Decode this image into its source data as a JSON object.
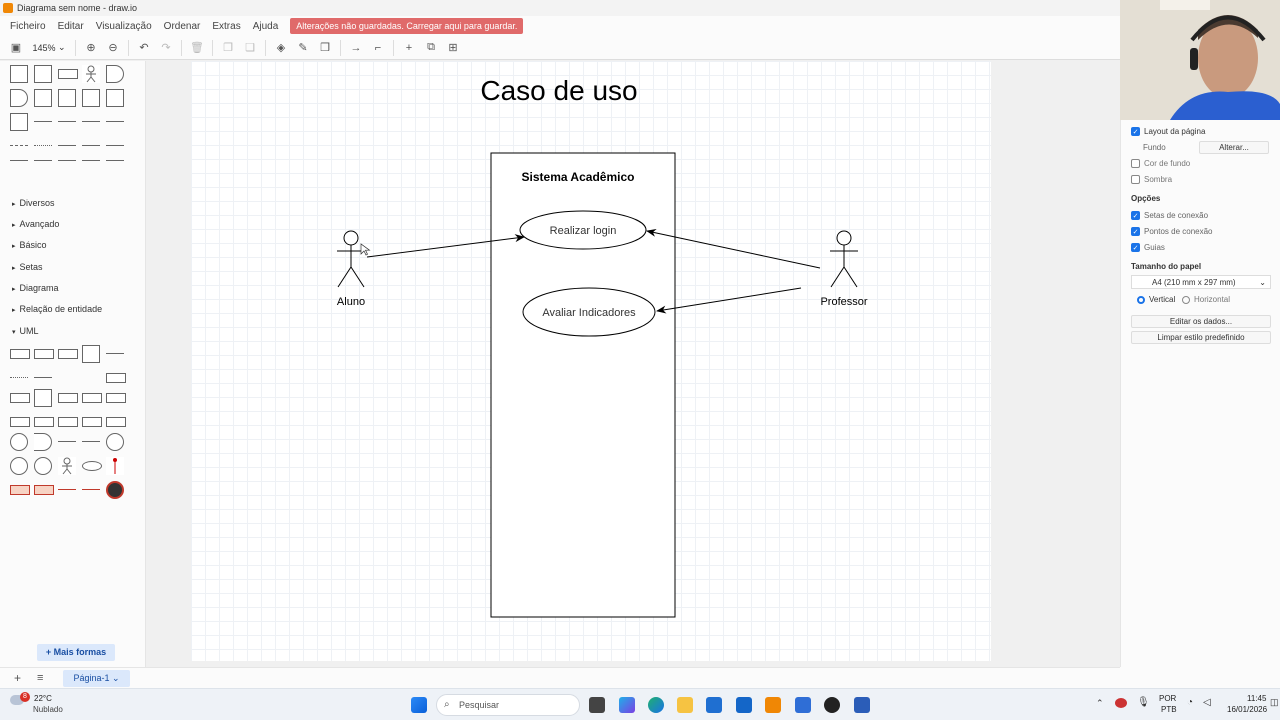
{
  "window": {
    "title": "Diagrama sem nome - draw.io"
  },
  "menu": {
    "items": [
      "Ficheiro",
      "Editar",
      "Visualização",
      "Ordenar",
      "Extras",
      "Ajuda"
    ],
    "unsaved_notice": "Alterações não guardadas. Carregar aqui para guardar."
  },
  "toolbar": {
    "zoom": "145%"
  },
  "sidebar": {
    "categories": [
      "Diversos",
      "Avançado",
      "Básico",
      "Setas",
      "Diagrama",
      "Relação de entidade",
      "UML"
    ],
    "more_shapes": "+ Mais formas"
  },
  "diagram": {
    "title": "Caso de uso",
    "system_label": "Sistema Acadêmico",
    "actor_left": "Aluno",
    "actor_right": "Professor",
    "usecase_1": "Realizar login",
    "usecase_2": "Avaliar Indicadores"
  },
  "format_panel": {
    "page_layout": "Layout da página",
    "background_label": "Fundo",
    "change_button": "Alterar...",
    "background_color": "Cor de fundo",
    "shadow": "Sombra",
    "options_title": "Opções",
    "connection_arrows": "Setas de conexão",
    "connection_points": "Pontos de conexão",
    "guides": "Guias",
    "paper_size_title": "Tamanho do papel",
    "paper_size": "A4 (210 mm x 297 mm)",
    "vertical": "Vertical",
    "horizontal": "Horizontal",
    "edit_data": "Editar os dados...",
    "clear_style": "Limpar estilo predefinido"
  },
  "pages": {
    "current": "Página-1"
  },
  "taskbar": {
    "weather_temp": "22°C",
    "weather_text": "Nublado",
    "weather_badge": "8",
    "search_placeholder": "Pesquisar",
    "lang": "POR",
    "layout": "PTB",
    "time": "11:45",
    "date": "16/01/2026"
  },
  "colors": {
    "accent": "#1a73e8",
    "unsaved_bg": "#e06a6a",
    "drawio_orange": "#f08705"
  }
}
